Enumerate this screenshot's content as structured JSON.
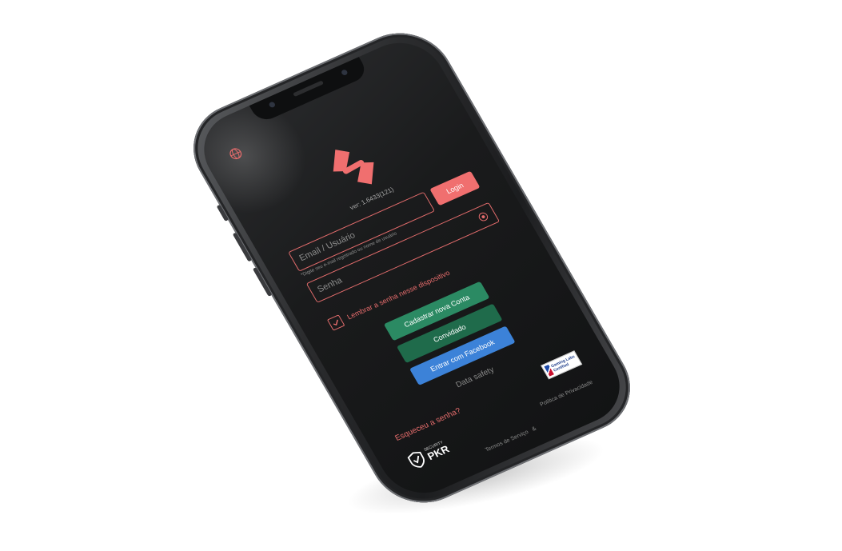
{
  "app": {
    "version": "ver: 1.6433(121)"
  },
  "login": {
    "email_placeholder": "Email / Usuário",
    "email_hint": "*Digite seu e-mail registrado ou nome de usuário",
    "login_button": "Login",
    "password_placeholder": "Senha",
    "remember_label": "Lembrar a senha nesse dispositivo",
    "remember_checked": true
  },
  "buttons": {
    "register": "Cadastrar nova Conta",
    "guest": "Convidado",
    "facebook": "Entrar com Facebook"
  },
  "links": {
    "data_safety": "Data safety",
    "forgot_password": "Esqueceu a senha?",
    "terms": "Termos de Serviço",
    "separator": "&",
    "privacy": "Política de Privacidade"
  },
  "badges": {
    "gaming_text": "Gaming Labs Certified",
    "security_small": "SECURITY",
    "security_big": "PKR"
  },
  "colors": {
    "accent": "#f06f6f",
    "register": "#2b8a63",
    "guest": "#1f6b4b",
    "facebook": "#3c82d8",
    "background": "#1a1b1c"
  },
  "icons": {
    "language": "globe-icon",
    "logo": "brand-logo-icon",
    "password_visibility": "eye-icon",
    "checkbox": "check-icon",
    "security": "shield-icon"
  }
}
